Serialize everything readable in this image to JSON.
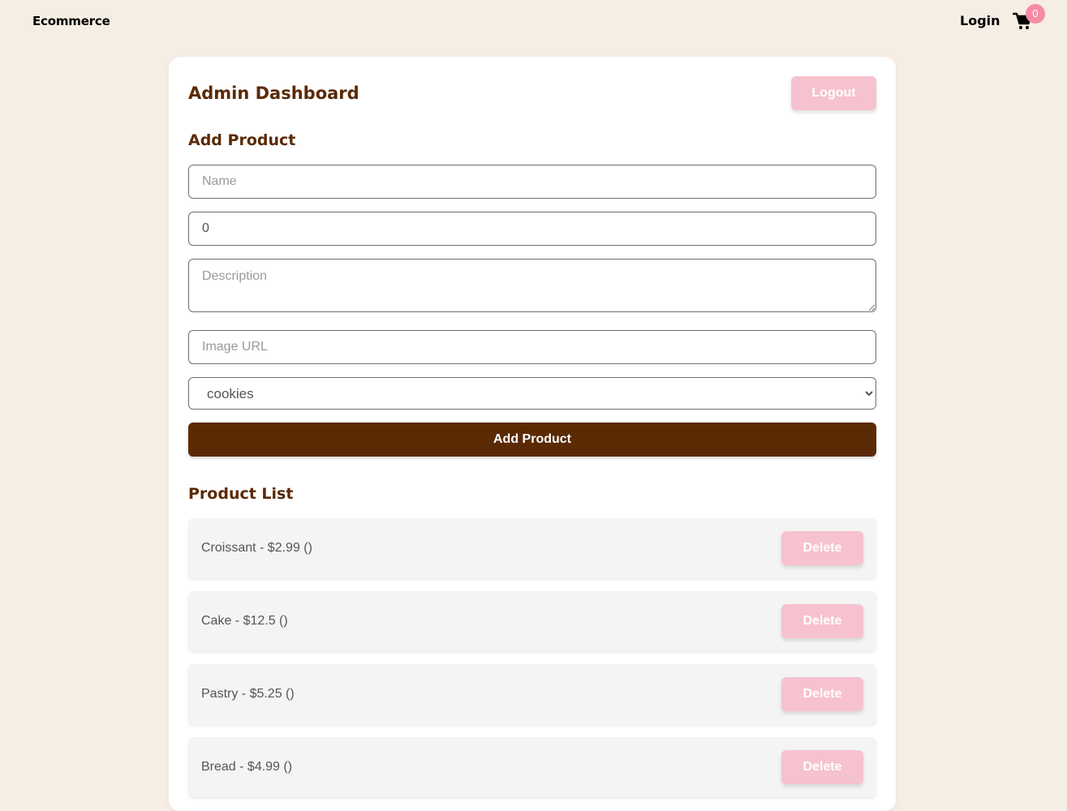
{
  "navbar": {
    "brand": "Ecommerce",
    "login_label": "Login",
    "cart_icon": "cart-icon",
    "cart_count": "0"
  },
  "dashboard": {
    "title": "Admin Dashboard",
    "logout_label": "Logout"
  },
  "add_product": {
    "section_title": "Add Product",
    "name_placeholder": "Name",
    "price_value": "0",
    "description_placeholder": "Description",
    "image_url_placeholder": "Image URL",
    "category_selected": "cookies",
    "submit_label": "Add Product"
  },
  "product_list": {
    "section_title": "Product List",
    "items": [
      {
        "text": "Croissant - $2.99 ()",
        "delete_label": "Delete"
      },
      {
        "text": "Cake - $12.5 ()",
        "delete_label": "Delete"
      },
      {
        "text": "Pastry - $5.25 ()",
        "delete_label": "Delete"
      },
      {
        "text": "Bread - $4.99 ()",
        "delete_label": "Delete"
      }
    ]
  },
  "colors": {
    "background": "#f6ede4",
    "brand_brown": "#5a2a05",
    "pink_button": "#f6c2cf",
    "badge_pink": "#f58ba5"
  }
}
